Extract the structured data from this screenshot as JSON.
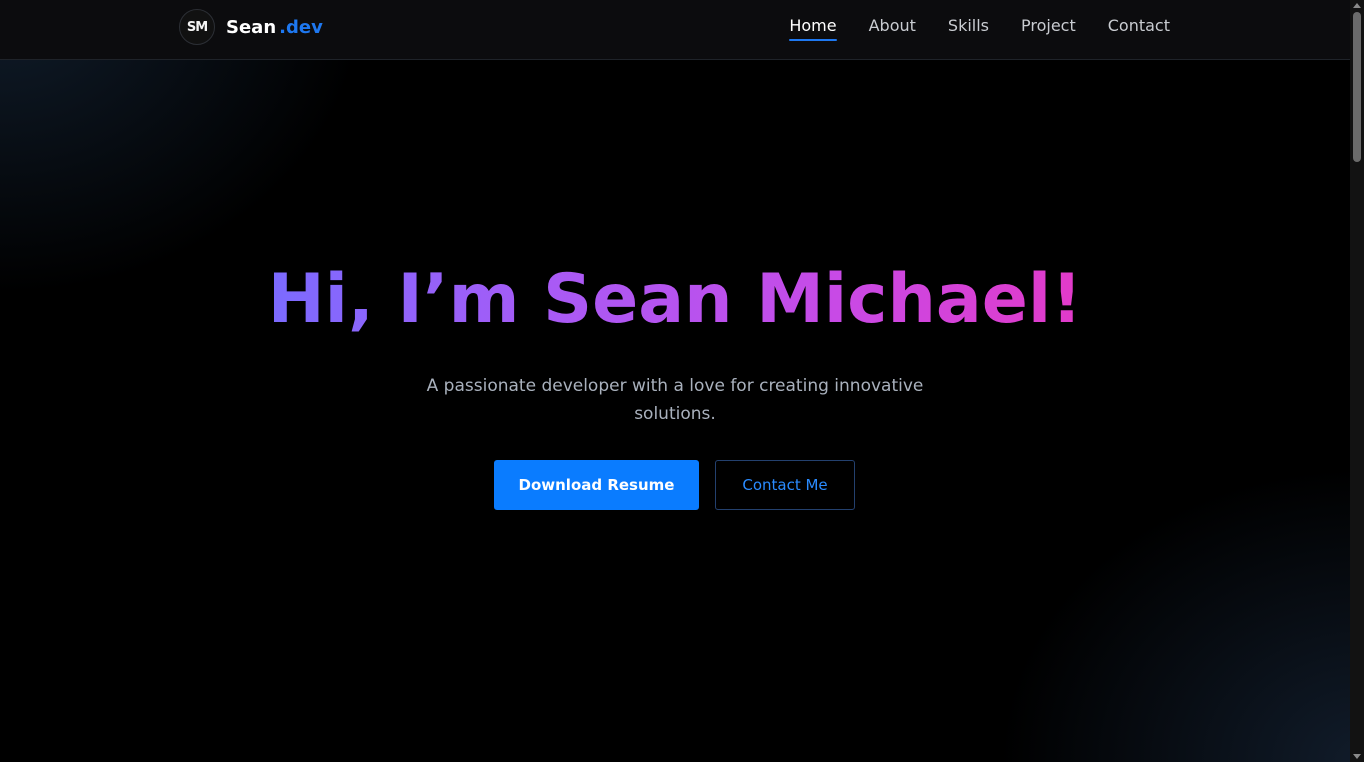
{
  "brand": {
    "logo_text": "SM",
    "name": "Sean",
    "dot": ".",
    "suffix": "dev"
  },
  "nav": {
    "items": [
      {
        "label": "Home",
        "active": true
      },
      {
        "label": "About",
        "active": false
      },
      {
        "label": "Skills",
        "active": false
      },
      {
        "label": "Project",
        "active": false
      },
      {
        "label": "Contact",
        "active": false
      }
    ]
  },
  "hero": {
    "title": "Hi, I’m Sean Michael!",
    "subtitle": "A passionate developer with a love for creating innovative solutions.",
    "primary_button": "Download Resume",
    "secondary_button": "Contact Me"
  },
  "colors": {
    "accent": "#0a7cff",
    "gradient_start": "#7b6bff",
    "gradient_end": "#e23ac9",
    "background": "#000000"
  }
}
